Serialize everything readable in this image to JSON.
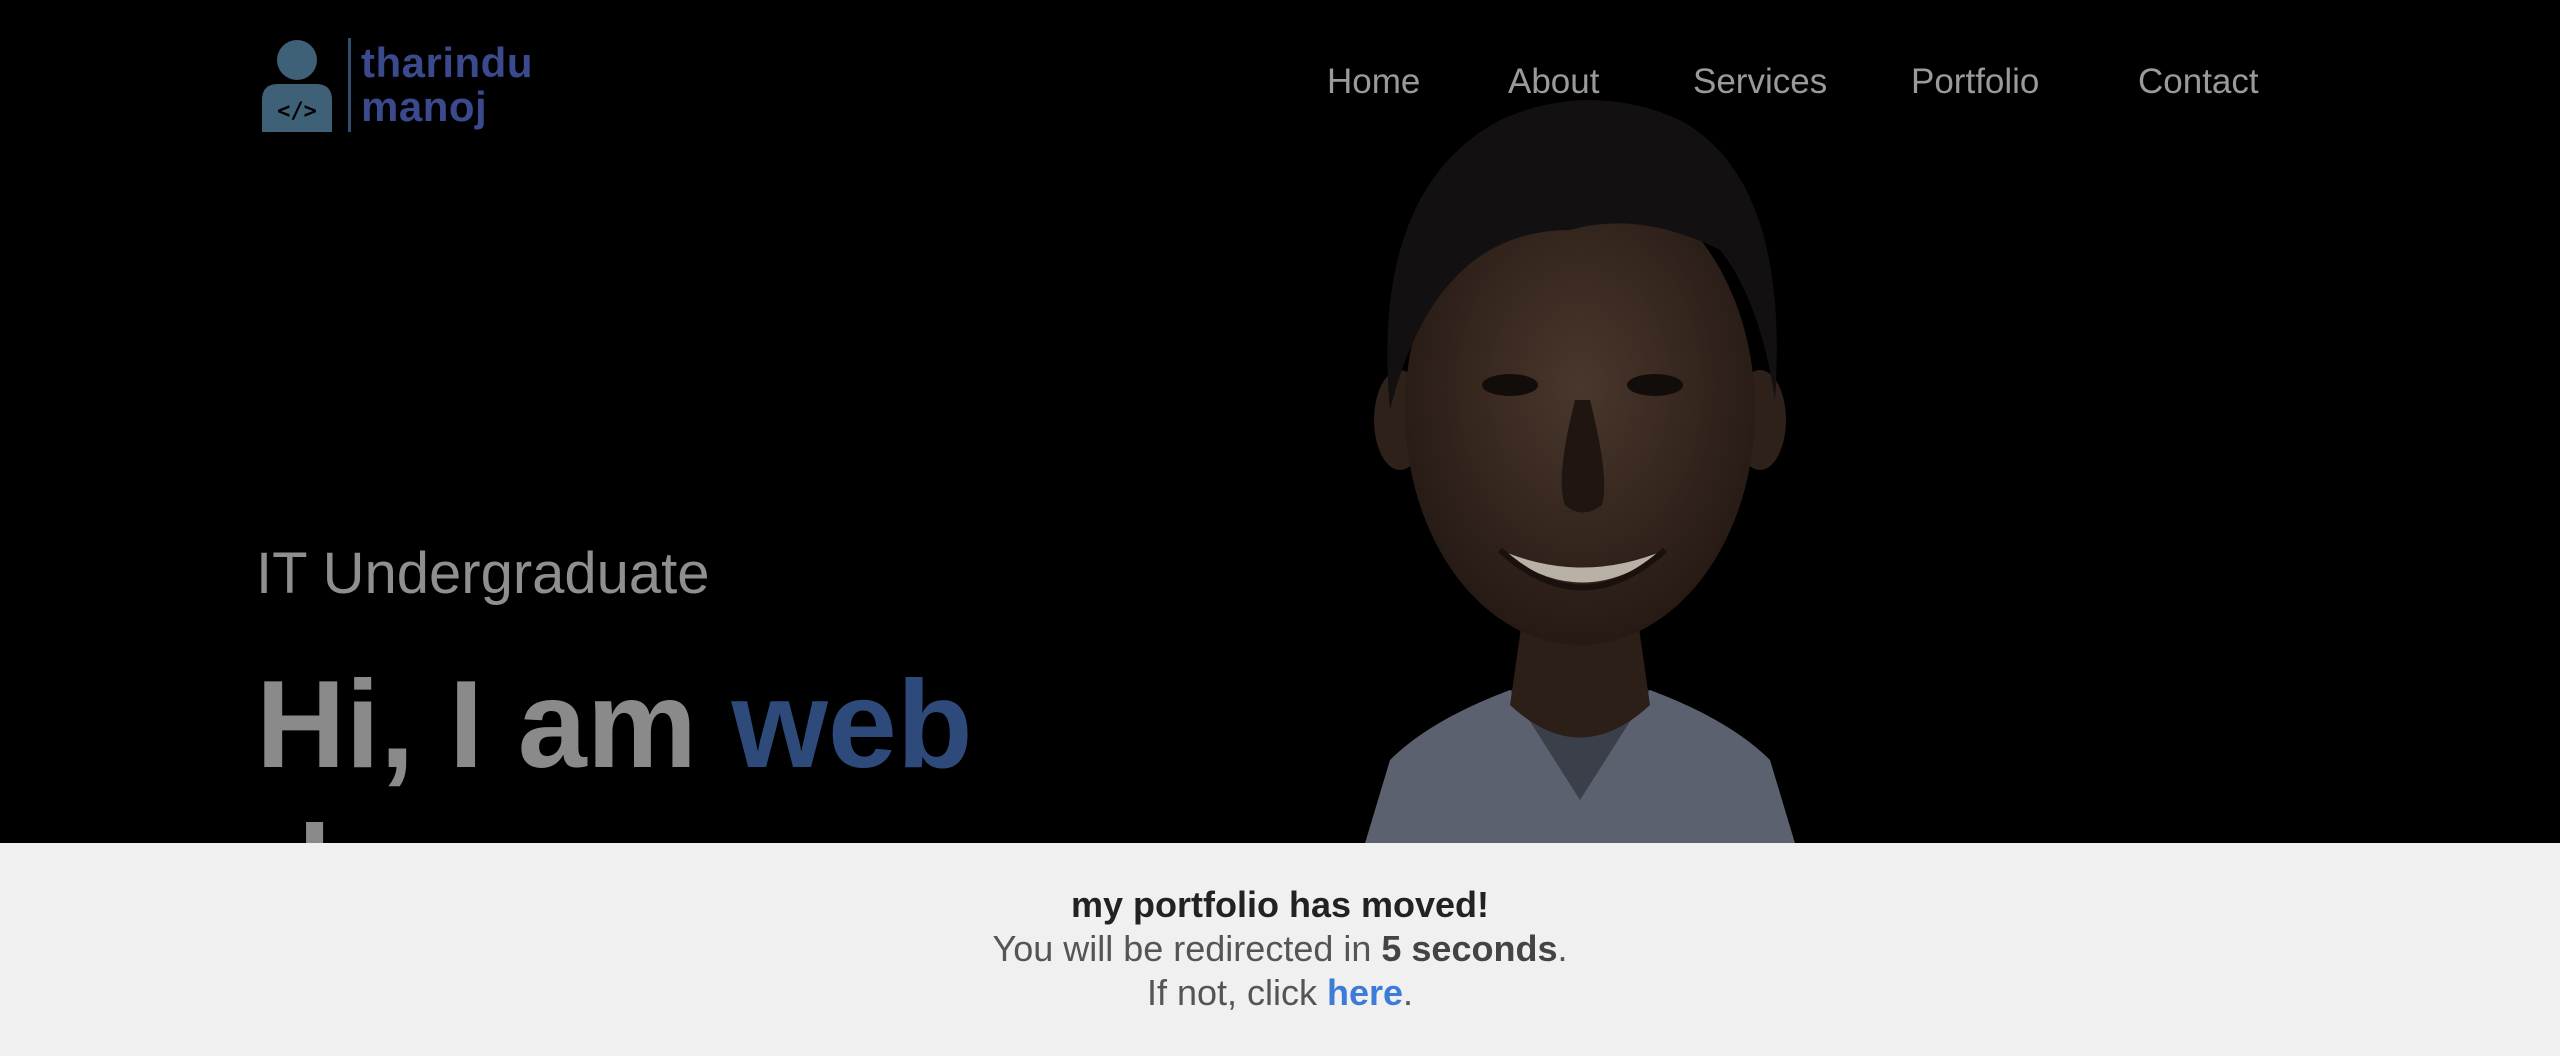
{
  "logo": {
    "line1": "tharindu",
    "line2": "manoj",
    "icon": "developer-avatar-icon",
    "icon_glyph": "</>"
  },
  "nav": {
    "items": [
      "Home",
      "About",
      "Services",
      "Portfolio",
      "Contact"
    ]
  },
  "hero": {
    "subtitle": "IT Undergraduate",
    "headline_prefix": "Hi, I am ",
    "headline_accent": "web",
    "headline_line2": "dev"
  },
  "notice": {
    "title": "my portfolio has moved!",
    "redirect_prefix": "You will be redirected in ",
    "redirect_time": "5 seconds",
    "redirect_suffix": ".",
    "click_prefix": "If not, click ",
    "click_link": "here",
    "click_suffix": "."
  },
  "colors": {
    "background": "#000000",
    "accent": "#2d4a7a",
    "logo_text": "#3b4a8c",
    "banner_bg": "#f0f0f0",
    "link": "#3d7bd9"
  }
}
